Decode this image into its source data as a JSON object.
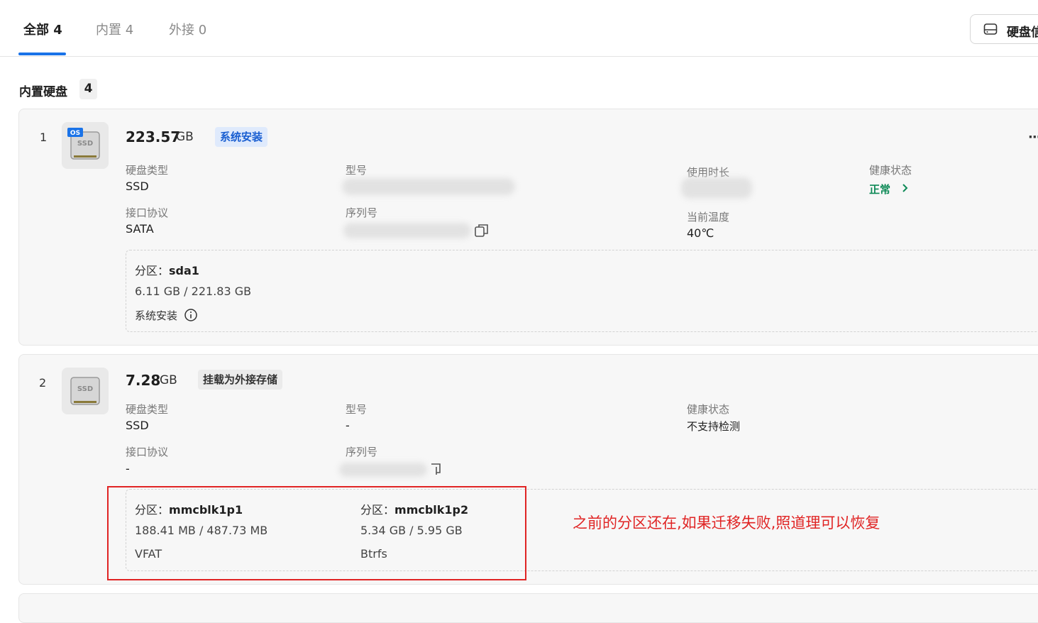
{
  "tabs": [
    {
      "label": "全部 4"
    },
    {
      "label": "内置 4"
    },
    {
      "label": "外接 0"
    }
  ],
  "disk_info_button": "硬盘信",
  "section": {
    "title": "内置硬盘",
    "count": "4"
  },
  "disks": [
    {
      "index": "1",
      "icon_badge": "OS",
      "icon_text": "SSD",
      "size": "223.57",
      "unit": "GB",
      "tag": "系统安装",
      "fields": {
        "type_label": "硬盘类型",
        "type_value": "SSD",
        "model_label": "型号",
        "interface_label": "接口协议",
        "interface_value": "SATA",
        "serial_label": "序列号",
        "uptime_label": "使用时长",
        "temp_label": "当前温度",
        "temp_value": "40℃",
        "health_label": "健康状态",
        "health_value": "正常"
      },
      "partitions": [
        {
          "label": "分区：",
          "name": "sda1",
          "usage": "6.11 GB / 221.83 GB",
          "note": "系统安装"
        }
      ]
    },
    {
      "index": "2",
      "icon_text": "SSD",
      "size": "7.28",
      "unit": "GB",
      "tag": "挂载为外接存储",
      "fields": {
        "type_label": "硬盘类型",
        "type_value": "SSD",
        "model_label": "型号",
        "model_value": "-",
        "interface_label": "接口协议",
        "interface_value": "-",
        "serial_label": "序列号",
        "health_label": "健康状态",
        "health_value": "不支持检测"
      },
      "partitions": [
        {
          "label": "分区：",
          "name": "mmcblk1p1",
          "usage": "188.41 MB / 487.73 MB",
          "fs": "VFAT"
        },
        {
          "label": "分区：",
          "name": "mmcblk1p2",
          "usage": "5.34 GB / 5.95 GB",
          "fs": "Btrfs"
        }
      ]
    }
  ],
  "annotation": "之前的分区还在,如果迁移失败,照道理可以恢复",
  "more_menu": "···",
  "colors": {
    "accent": "#1a73e8",
    "healthy": "#0e8a57",
    "annotation": "#e02424"
  }
}
